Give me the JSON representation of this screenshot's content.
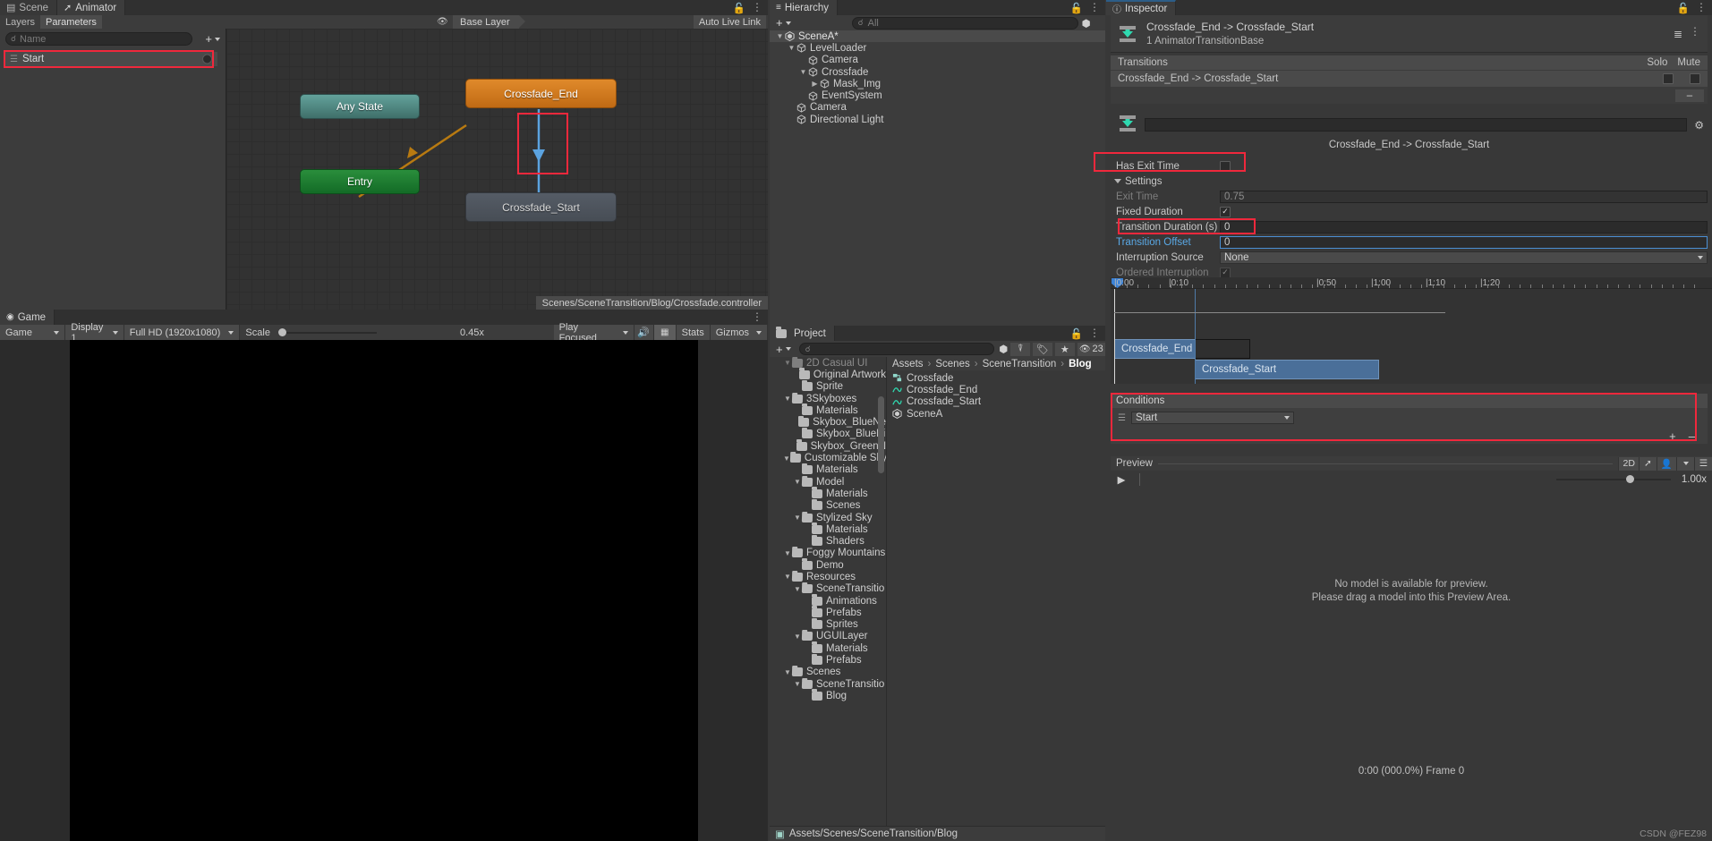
{
  "animator": {
    "tabs": [
      {
        "label": "Scene",
        "icon": "grid-icon",
        "active": false
      },
      {
        "label": "Animator",
        "icon": "animator-icon",
        "active": true
      }
    ],
    "subtabs": [
      {
        "label": "Layers",
        "on": false
      },
      {
        "label": "Parameters",
        "on": true
      }
    ],
    "search_placeholder": "Name",
    "parameter_row": {
      "label": "Start",
      "type": "trigger"
    },
    "layer_crumb": "Base Layer",
    "auto_live_link": "Auto Live Link",
    "status_path": "Scenes/SceneTransition/Blog/Crossfade.controller",
    "nodes": [
      {
        "label": "Any State",
        "kind": "any"
      },
      {
        "label": "Entry",
        "kind": "entry"
      },
      {
        "label": "Crossfade_End",
        "kind": "orange"
      },
      {
        "label": "Crossfade_Start",
        "kind": "grey"
      }
    ]
  },
  "game": {
    "tabs": [
      {
        "label": "Game",
        "icon": "game-icon",
        "active": true
      }
    ],
    "toolbar": {
      "mode": "Game",
      "display": "Display 1",
      "resolution": "Full HD (1920x1080)",
      "scale_label": "Scale",
      "scale_value": "0.45x",
      "play_focused": "Play Focused",
      "stats": "Stats",
      "gizmos": "Gizmos"
    }
  },
  "hierarchy": {
    "tab": "Hierarchy",
    "search_placeholder": "All",
    "items": [
      {
        "label": "SceneA*",
        "depth": 0,
        "arrow": "down",
        "icon": "unity-scene-icon",
        "selected": true
      },
      {
        "label": "LevelLoader",
        "depth": 1,
        "arrow": "down",
        "icon": "cube-icon",
        "selected": false
      },
      {
        "label": "Camera",
        "depth": 2,
        "arrow": "none",
        "icon": "cube-icon",
        "selected": false
      },
      {
        "label": "Crossfade",
        "depth": 2,
        "arrow": "down",
        "icon": "cube-icon",
        "selected": false
      },
      {
        "label": "Mask_Img",
        "depth": 3,
        "arrow": "right",
        "icon": "cube-icon",
        "selected": false
      },
      {
        "label": "EventSystem",
        "depth": 2,
        "arrow": "none",
        "icon": "cube-icon",
        "selected": false
      },
      {
        "label": "Camera",
        "depth": 1,
        "arrow": "none",
        "icon": "cube-icon",
        "selected": false
      },
      {
        "label": "Directional Light",
        "depth": 1,
        "arrow": "none",
        "icon": "cube-icon",
        "selected": false
      }
    ]
  },
  "project": {
    "tab": "Project",
    "search_placeholder": "",
    "asset_count": "23",
    "breadcrumbs": [
      "Assets",
      "Scenes",
      "SceneTransition",
      "Blog"
    ],
    "status_path": "Assets/Scenes/SceneTransition/Blog",
    "tree": [
      {
        "label": "2D Casual UI",
        "depth": 1,
        "arrow": "down",
        "open": true,
        "clipped": true
      },
      {
        "label": "Original Artwork",
        "depth": 2,
        "arrow": "none",
        "open": false
      },
      {
        "label": "Sprite",
        "depth": 2,
        "arrow": "none",
        "open": false
      },
      {
        "label": "3Skyboxes",
        "depth": 1,
        "arrow": "down",
        "open": true
      },
      {
        "label": "Materials",
        "depth": 2,
        "arrow": "none",
        "open": false
      },
      {
        "label": "Skybox_BlueNe",
        "depth": 2,
        "arrow": "none",
        "open": false
      },
      {
        "label": "Skybox_BluePi",
        "depth": 2,
        "arrow": "none",
        "open": false
      },
      {
        "label": "Skybox_GreenN",
        "depth": 2,
        "arrow": "none",
        "open": false
      },
      {
        "label": "Customizable Sky",
        "depth": 1,
        "arrow": "down",
        "open": true
      },
      {
        "label": "Materials",
        "depth": 2,
        "arrow": "none",
        "open": false
      },
      {
        "label": "Model",
        "depth": 2,
        "arrow": "down",
        "open": true
      },
      {
        "label": "Materials",
        "depth": 3,
        "arrow": "none",
        "open": false
      },
      {
        "label": "Scenes",
        "depth": 3,
        "arrow": "none",
        "open": false
      },
      {
        "label": "Stylized Sky",
        "depth": 2,
        "arrow": "down",
        "open": true
      },
      {
        "label": "Materials",
        "depth": 3,
        "arrow": "none",
        "open": false
      },
      {
        "label": "Shaders",
        "depth": 3,
        "arrow": "none",
        "open": false
      },
      {
        "label": "Foggy Mountains",
        "depth": 1,
        "arrow": "down",
        "open": true
      },
      {
        "label": "Demo",
        "depth": 2,
        "arrow": "none",
        "open": false
      },
      {
        "label": "Resources",
        "depth": 1,
        "arrow": "down",
        "open": true
      },
      {
        "label": "SceneTransitio",
        "depth": 2,
        "arrow": "down",
        "open": true
      },
      {
        "label": "Animations",
        "depth": 3,
        "arrow": "none",
        "open": false
      },
      {
        "label": "Prefabs",
        "depth": 3,
        "arrow": "none",
        "open": false
      },
      {
        "label": "Sprites",
        "depth": 3,
        "arrow": "none",
        "open": false
      },
      {
        "label": "UGUILayer",
        "depth": 2,
        "arrow": "down",
        "open": true
      },
      {
        "label": "Materials",
        "depth": 3,
        "arrow": "none",
        "open": false
      },
      {
        "label": "Prefabs",
        "depth": 3,
        "arrow": "none",
        "open": false
      },
      {
        "label": "Scenes",
        "depth": 1,
        "arrow": "down",
        "open": true
      },
      {
        "label": "SceneTransitio",
        "depth": 2,
        "arrow": "down",
        "open": true
      },
      {
        "label": "Blog",
        "depth": 3,
        "arrow": "none",
        "open": false
      }
    ],
    "assets": [
      {
        "label": "Crossfade",
        "icon": "animator-controller-icon"
      },
      {
        "label": "Crossfade_End",
        "icon": "animation-clip-icon"
      },
      {
        "label": "Crossfade_Start",
        "icon": "animation-clip-icon"
      },
      {
        "label": "SceneA",
        "icon": "unity-scene-icon"
      }
    ]
  },
  "inspector": {
    "tab": "Inspector",
    "title": "Crossfade_End -> Crossfade_Start",
    "subtitle": "1 AnimatorTransitionBase",
    "transitions_header": "Transitions",
    "solo_label": "Solo",
    "mute_label": "Mute",
    "transition_item": "Crossfade_End -> Crossfade_Start",
    "minus_label": "–",
    "name_field_value": "",
    "transition_name": "Crossfade_End -> Crossfade_Start",
    "has_exit_time": {
      "label": "Has Exit Time",
      "checked": false
    },
    "settings_label": "Settings",
    "fields": [
      {
        "label": "Exit Time",
        "value": "0.75",
        "type": "text",
        "dim": true
      },
      {
        "label": "Fixed Duration",
        "value": "✓",
        "type": "check",
        "checked": true
      },
      {
        "label": "Transition Duration (s)",
        "value": "0",
        "type": "text",
        "highlight": true
      },
      {
        "label": "Transition Offset",
        "value": "0",
        "type": "text",
        "blue": true,
        "focus": true
      },
      {
        "label": "Interruption Source",
        "value": "None",
        "type": "dropdown"
      },
      {
        "label": "Ordered Interruption",
        "value": "✓",
        "type": "check",
        "checked": true,
        "dim": true
      }
    ],
    "timeline": {
      "ticks": [
        "0:00",
        "0:10",
        "0:50",
        "1:00",
        "1:10",
        "1:20"
      ],
      "clips": [
        {
          "label": "Crossfade_End"
        },
        {
          "label": "Crossfade_Start"
        }
      ]
    },
    "conditions": {
      "header": "Conditions",
      "rows": [
        {
          "param": "Start"
        }
      ],
      "add_label": "+",
      "remove_label": "–"
    },
    "preview": {
      "label": "Preview",
      "btn_2d": "2D",
      "speed": "1.00x",
      "empty_line1": "No model is available for preview.",
      "empty_line2": "Please drag a model into this Preview Area.",
      "frame_label": "0:00 (000.0%) Frame 0"
    },
    "watermark": "CSDN @FEZ98"
  },
  "colors": {
    "accent_red": "#f0283c",
    "orange_node": "#e08a2b",
    "blue_arrow": "#4da3e8",
    "teal": "#63a29b",
    "green": "#2a8e3c"
  }
}
